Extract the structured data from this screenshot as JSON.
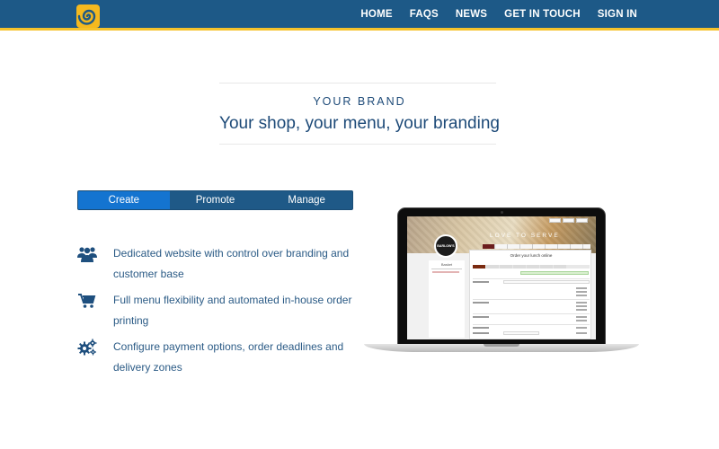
{
  "nav": {
    "logo_icon": "spiral-logo-icon",
    "items": [
      "HOME",
      "FAQS",
      "NEWS",
      "GET IN TOUCH",
      "SIGN IN"
    ]
  },
  "hero": {
    "kicker": "YOUR BRAND",
    "tagline": "Your shop, your menu, your branding"
  },
  "tabs": {
    "items": [
      "Create",
      "Promote",
      "Manage"
    ],
    "active": "Create"
  },
  "features": [
    {
      "icon": "users-icon",
      "text": "Dedicated website with control over branding and customer base"
    },
    {
      "icon": "cart-icon",
      "text": "Full menu flexibility and automated in-house order printing"
    },
    {
      "icon": "gears-icon",
      "text": "Configure payment options, order deadlines and delivery zones"
    }
  ],
  "laptop_screen": {
    "banner_text": "LOVE TO SERVE",
    "badge_text": "BARLOW'S",
    "left_title": "Basket",
    "main_title": "Order your lunch online"
  },
  "colors": {
    "nav_bg": "#1d5987",
    "nav_stripe": "#f5c22b",
    "logo_bg": "#f4b91f",
    "heading": "#1d4a78",
    "tab_active": "#1474d0",
    "tab_bg": "#1f5987"
  }
}
